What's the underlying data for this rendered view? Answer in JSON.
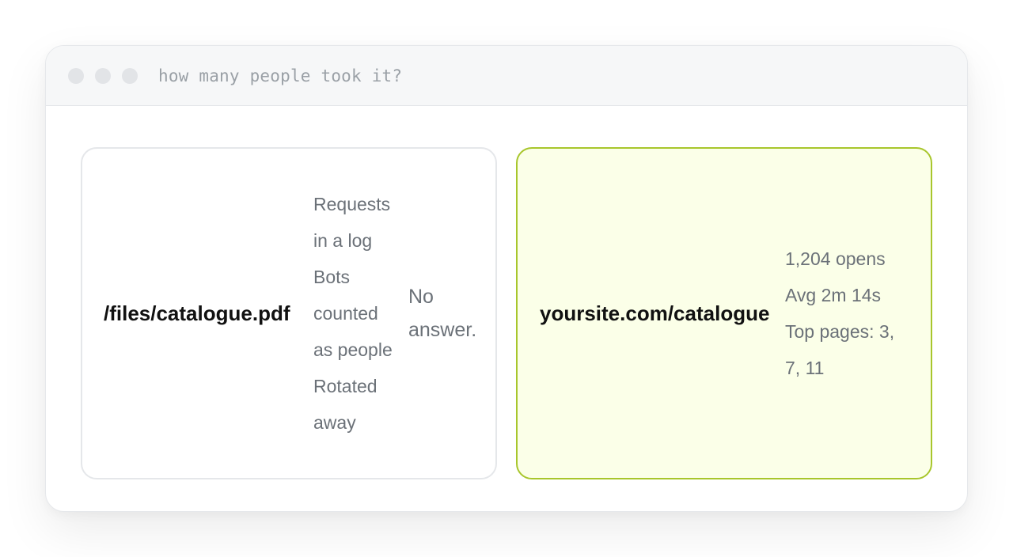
{
  "window": {
    "title": "how many people took it?"
  },
  "cards": {
    "left": {
      "name": "/files/catalogue.pdf",
      "stats": [
        "Requests in a log",
        "Bots counted as people",
        "Rotated away"
      ],
      "verdict": "No answer."
    },
    "right": {
      "name": "yoursite.com/catalogue",
      "stats": [
        "1,204 opens",
        "Avg 2m 14s",
        "Top pages: 3, 7, 11"
      ]
    }
  },
  "colors": {
    "accent_border": "#a8c62c",
    "accent_background": "#fbffe8"
  }
}
